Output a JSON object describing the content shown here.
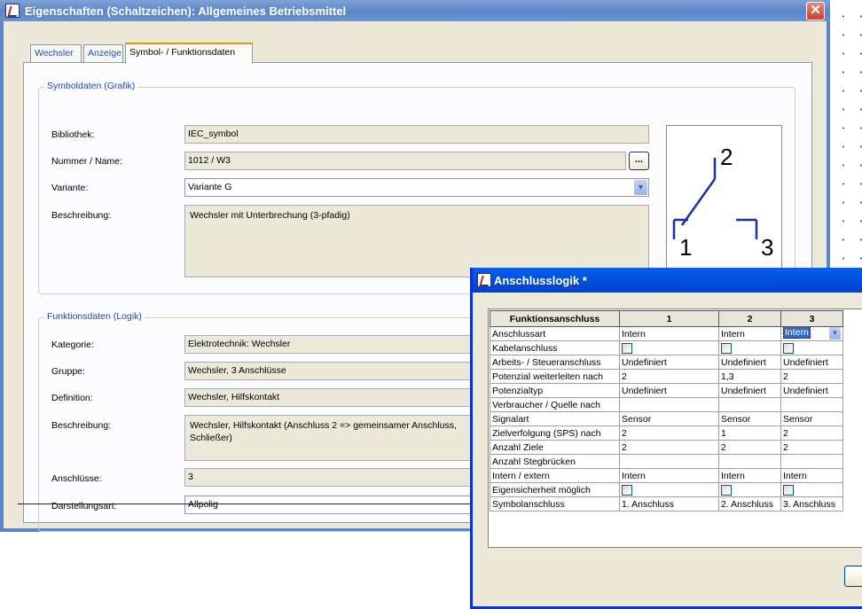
{
  "main_window": {
    "title": "Eigenschaften (Schaltzeichen): Allgemeines Betriebsmittel",
    "close_glyph": "✕",
    "tabs": [
      {
        "label": "Wechsler",
        "active": false
      },
      {
        "label": "Anzeige",
        "active": false
      },
      {
        "label": "Symbol- / Funktionsdaten",
        "active": true
      }
    ],
    "symbol_group": {
      "legend": "Symboldaten (Grafik)",
      "bibliothek_label": "Bibliothek:",
      "bibliothek_value": "IEC_symbol",
      "nummer_label": "Nummer / Name:",
      "nummer_value": "1012 / W3",
      "browse_label": "...",
      "variante_label": "Variante:",
      "variante_value": "Variante G",
      "beschreibung_label": "Beschreibung:",
      "beschreibung_value": "Wechsler mit Unterbrechung (3-pfadig)",
      "preview_labels": [
        "2",
        "1",
        "3"
      ]
    },
    "function_group": {
      "legend": "Funktionsdaten (Logik)",
      "kategorie_label": "Kategorie:",
      "kategorie_value": "Elektrotechnik: Wechsler",
      "gruppe_label": "Gruppe:",
      "gruppe_value": "Wechsler, 3 Anschlüsse",
      "definition_label": "Definition:",
      "definition_value": "Wechsler, Hilfskontakt",
      "beschreibung_label": "Beschreibung:",
      "beschreibung_value": "Wechsler, Hilfskontakt (Anschluss 2 => gemeinsamer Anschluss, Schließer)",
      "anschluesse_label": "Anschlüsse:",
      "anschluesse_value": "3",
      "darstellung_label": "Darstellungsart:",
      "darstellung_value": "Allpolig"
    }
  },
  "dialog": {
    "title": "Anschlusslogik *",
    "headers": [
      "Funktionsanschluss",
      "1",
      "2",
      "3"
    ],
    "rows": [
      {
        "label": "Anschlussart",
        "values": [
          "Intern",
          "Intern",
          "Intern"
        ],
        "type": "text"
      },
      {
        "label": "Kabelanschluss",
        "values": [
          "",
          "",
          ""
        ],
        "type": "checkbox"
      },
      {
        "label": "Arbeits- / Steueranschluss",
        "values": [
          "Undefiniert",
          "Undefiniert",
          "Undefiniert"
        ],
        "type": "text"
      },
      {
        "label": "Potenzial weiterleiten nach",
        "values": [
          "2",
          "1,3",
          "2"
        ],
        "type": "text"
      },
      {
        "label": "Potenzialtyp",
        "values": [
          "Undefiniert",
          "Undefiniert",
          "Undefiniert"
        ],
        "type": "text"
      },
      {
        "label": "Verbraucher / Quelle nach",
        "values": [
          "",
          "",
          ""
        ],
        "type": "text"
      },
      {
        "label": "Signalart",
        "values": [
          "Sensor",
          "Sensor",
          "Sensor"
        ],
        "type": "text"
      },
      {
        "label": "Zielverfolgung (SPS) nach",
        "values": [
          "2",
          "1",
          "2"
        ],
        "type": "text"
      },
      {
        "label": "Anzahl Ziele",
        "values": [
          "2",
          "2",
          "2"
        ],
        "type": "text"
      },
      {
        "label": "Anzahl Stegbrücken",
        "values": [
          "",
          "",
          ""
        ],
        "type": "text"
      },
      {
        "label": "Intern / extern",
        "values": [
          "Intern",
          "Intern",
          "Intern"
        ],
        "type": "text"
      },
      {
        "label": "Eigensicherheit möglich",
        "values": [
          "",
          "",
          ""
        ],
        "type": "checkbox"
      },
      {
        "label": "Symbolanschluss",
        "values": [
          "1. Anschluss",
          "2. Anschluss",
          "3. Anschluss"
        ],
        "type": "text"
      }
    ]
  },
  "colors": {
    "main_title": "#5b86c8",
    "dialog_title": "#0054e3",
    "group_legend": "#2147b0",
    "symbol_stroke": "#1a2fb8"
  }
}
